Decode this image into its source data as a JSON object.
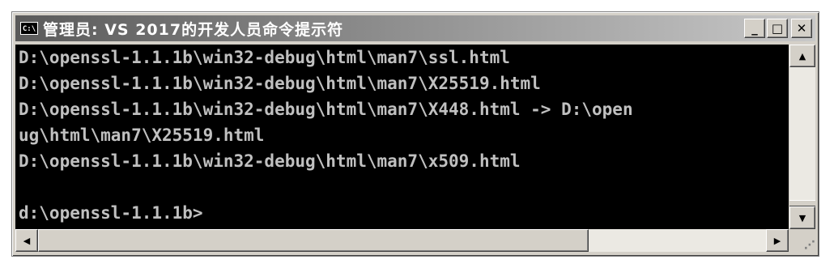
{
  "window": {
    "title": "管理员: VS 2017的开发人员命令提示符",
    "icon_label": "C:\\",
    "buttons": {
      "minimize": "_",
      "maximize": "□",
      "close": "✕"
    }
  },
  "console": {
    "lines": [
      "D:\\openssl-1.1.1b\\win32-debug\\html\\man7\\ssl.html",
      "D:\\openssl-1.1.1b\\win32-debug\\html\\man7\\X25519.html",
      "D:\\openssl-1.1.1b\\win32-debug\\html\\man7\\X448.html -> D:\\open",
      "ug\\html\\man7\\X25519.html",
      "D:\\openssl-1.1.1b\\win32-debug\\html\\man7\\x509.html",
      "",
      "d:\\openssl-1.1.1b>"
    ]
  },
  "scrollbars": {
    "up_arrow": "▲",
    "down_arrow": "▼",
    "left_arrow": "◀",
    "right_arrow": "▶",
    "grip": "⋰"
  }
}
